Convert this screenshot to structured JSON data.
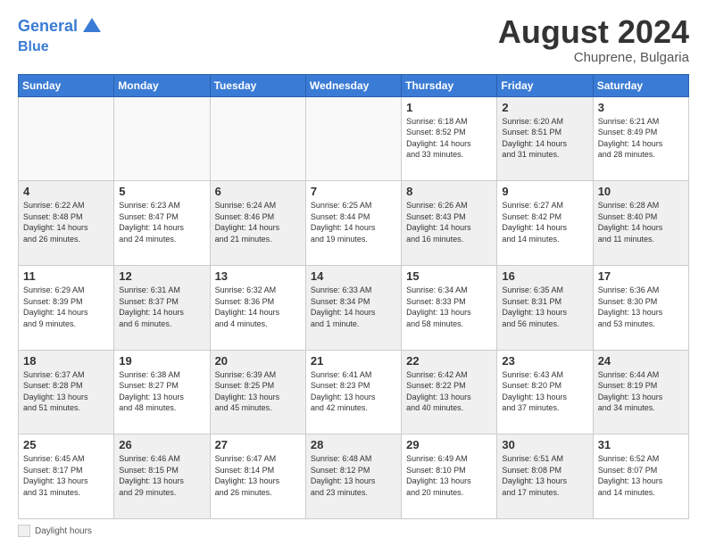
{
  "header": {
    "logo_line1": "General",
    "logo_line2": "Blue",
    "month_year": "August 2024",
    "location": "Chuprene, Bulgaria"
  },
  "footer": {
    "legend_label": "Daylight hours"
  },
  "weekdays": [
    "Sunday",
    "Monday",
    "Tuesday",
    "Wednesday",
    "Thursday",
    "Friday",
    "Saturday"
  ],
  "weeks": [
    [
      {
        "day": "",
        "info": "",
        "shaded": false
      },
      {
        "day": "",
        "info": "",
        "shaded": false
      },
      {
        "day": "",
        "info": "",
        "shaded": false
      },
      {
        "day": "",
        "info": "",
        "shaded": false
      },
      {
        "day": "1",
        "info": "Sunrise: 6:18 AM\nSunset: 8:52 PM\nDaylight: 14 hours\nand 33 minutes.",
        "shaded": false
      },
      {
        "day": "2",
        "info": "Sunrise: 6:20 AM\nSunset: 8:51 PM\nDaylight: 14 hours\nand 31 minutes.",
        "shaded": true
      },
      {
        "day": "3",
        "info": "Sunrise: 6:21 AM\nSunset: 8:49 PM\nDaylight: 14 hours\nand 28 minutes.",
        "shaded": false
      }
    ],
    [
      {
        "day": "4",
        "info": "Sunrise: 6:22 AM\nSunset: 8:48 PM\nDaylight: 14 hours\nand 26 minutes.",
        "shaded": true
      },
      {
        "day": "5",
        "info": "Sunrise: 6:23 AM\nSunset: 8:47 PM\nDaylight: 14 hours\nand 24 minutes.",
        "shaded": false
      },
      {
        "day": "6",
        "info": "Sunrise: 6:24 AM\nSunset: 8:46 PM\nDaylight: 14 hours\nand 21 minutes.",
        "shaded": true
      },
      {
        "day": "7",
        "info": "Sunrise: 6:25 AM\nSunset: 8:44 PM\nDaylight: 14 hours\nand 19 minutes.",
        "shaded": false
      },
      {
        "day": "8",
        "info": "Sunrise: 6:26 AM\nSunset: 8:43 PM\nDaylight: 14 hours\nand 16 minutes.",
        "shaded": true
      },
      {
        "day": "9",
        "info": "Sunrise: 6:27 AM\nSunset: 8:42 PM\nDaylight: 14 hours\nand 14 minutes.",
        "shaded": false
      },
      {
        "day": "10",
        "info": "Sunrise: 6:28 AM\nSunset: 8:40 PM\nDaylight: 14 hours\nand 11 minutes.",
        "shaded": true
      }
    ],
    [
      {
        "day": "11",
        "info": "Sunrise: 6:29 AM\nSunset: 8:39 PM\nDaylight: 14 hours\nand 9 minutes.",
        "shaded": false
      },
      {
        "day": "12",
        "info": "Sunrise: 6:31 AM\nSunset: 8:37 PM\nDaylight: 14 hours\nand 6 minutes.",
        "shaded": true
      },
      {
        "day": "13",
        "info": "Sunrise: 6:32 AM\nSunset: 8:36 PM\nDaylight: 14 hours\nand 4 minutes.",
        "shaded": false
      },
      {
        "day": "14",
        "info": "Sunrise: 6:33 AM\nSunset: 8:34 PM\nDaylight: 14 hours\nand 1 minute.",
        "shaded": true
      },
      {
        "day": "15",
        "info": "Sunrise: 6:34 AM\nSunset: 8:33 PM\nDaylight: 13 hours\nand 58 minutes.",
        "shaded": false
      },
      {
        "day": "16",
        "info": "Sunrise: 6:35 AM\nSunset: 8:31 PM\nDaylight: 13 hours\nand 56 minutes.",
        "shaded": true
      },
      {
        "day": "17",
        "info": "Sunrise: 6:36 AM\nSunset: 8:30 PM\nDaylight: 13 hours\nand 53 minutes.",
        "shaded": false
      }
    ],
    [
      {
        "day": "18",
        "info": "Sunrise: 6:37 AM\nSunset: 8:28 PM\nDaylight: 13 hours\nand 51 minutes.",
        "shaded": true
      },
      {
        "day": "19",
        "info": "Sunrise: 6:38 AM\nSunset: 8:27 PM\nDaylight: 13 hours\nand 48 minutes.",
        "shaded": false
      },
      {
        "day": "20",
        "info": "Sunrise: 6:39 AM\nSunset: 8:25 PM\nDaylight: 13 hours\nand 45 minutes.",
        "shaded": true
      },
      {
        "day": "21",
        "info": "Sunrise: 6:41 AM\nSunset: 8:23 PM\nDaylight: 13 hours\nand 42 minutes.",
        "shaded": false
      },
      {
        "day": "22",
        "info": "Sunrise: 6:42 AM\nSunset: 8:22 PM\nDaylight: 13 hours\nand 40 minutes.",
        "shaded": true
      },
      {
        "day": "23",
        "info": "Sunrise: 6:43 AM\nSunset: 8:20 PM\nDaylight: 13 hours\nand 37 minutes.",
        "shaded": false
      },
      {
        "day": "24",
        "info": "Sunrise: 6:44 AM\nSunset: 8:19 PM\nDaylight: 13 hours\nand 34 minutes.",
        "shaded": true
      }
    ],
    [
      {
        "day": "25",
        "info": "Sunrise: 6:45 AM\nSunset: 8:17 PM\nDaylight: 13 hours\nand 31 minutes.",
        "shaded": false
      },
      {
        "day": "26",
        "info": "Sunrise: 6:46 AM\nSunset: 8:15 PM\nDaylight: 13 hours\nand 29 minutes.",
        "shaded": true
      },
      {
        "day": "27",
        "info": "Sunrise: 6:47 AM\nSunset: 8:14 PM\nDaylight: 13 hours\nand 26 minutes.",
        "shaded": false
      },
      {
        "day": "28",
        "info": "Sunrise: 6:48 AM\nSunset: 8:12 PM\nDaylight: 13 hours\nand 23 minutes.",
        "shaded": true
      },
      {
        "day": "29",
        "info": "Sunrise: 6:49 AM\nSunset: 8:10 PM\nDaylight: 13 hours\nand 20 minutes.",
        "shaded": false
      },
      {
        "day": "30",
        "info": "Sunrise: 6:51 AM\nSunset: 8:08 PM\nDaylight: 13 hours\nand 17 minutes.",
        "shaded": true
      },
      {
        "day": "31",
        "info": "Sunrise: 6:52 AM\nSunset: 8:07 PM\nDaylight: 13 hours\nand 14 minutes.",
        "shaded": false
      }
    ]
  ]
}
